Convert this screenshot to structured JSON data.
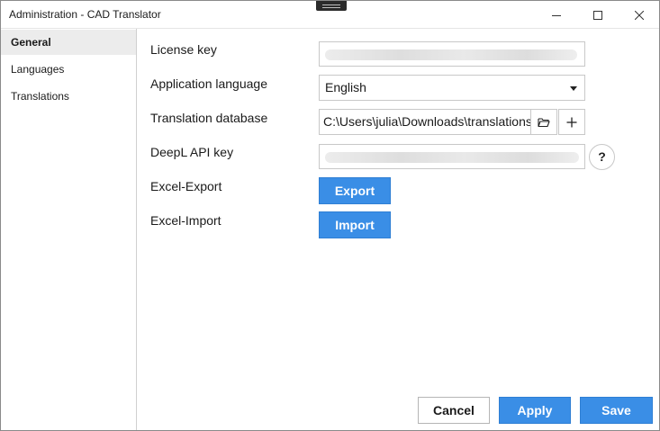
{
  "window": {
    "title": "Administration - CAD Translator"
  },
  "sidebar": {
    "items": [
      {
        "label": "General",
        "active": true
      },
      {
        "label": "Languages",
        "active": false
      },
      {
        "label": "Translations",
        "active": false
      }
    ]
  },
  "form": {
    "license_key": {
      "label": "License key",
      "value": ""
    },
    "app_language": {
      "label": "Application language",
      "value": "English"
    },
    "translation_db": {
      "label": "Translation database",
      "value": "C:\\Users\\julia\\Downloads\\translations"
    },
    "deepl_key": {
      "label": "DeepL API key",
      "value": "",
      "help": "?"
    },
    "excel_export": {
      "label": "Excel-Export",
      "button": "Export"
    },
    "excel_import": {
      "label": "Excel-Import",
      "button": "Import"
    }
  },
  "footer": {
    "cancel": "Cancel",
    "apply": "Apply",
    "save": "Save"
  },
  "colors": {
    "accent": "#3a8ee6",
    "selected_nav": "#ececec"
  }
}
